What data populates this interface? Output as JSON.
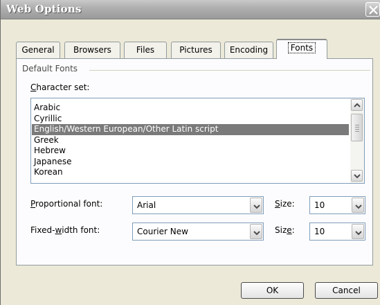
{
  "window": {
    "title": "Web Options",
    "close_icon": "close-icon"
  },
  "tabs": [
    {
      "label": "General",
      "active": false
    },
    {
      "label": "Browsers",
      "active": false
    },
    {
      "label": "Files",
      "active": false
    },
    {
      "label": "Pictures",
      "active": false
    },
    {
      "label": "Encoding",
      "active": false
    },
    {
      "label": "Fonts",
      "active": true
    }
  ],
  "fonts": {
    "group_label": "Default Fonts",
    "charset_label_prefix": "C",
    "charset_label_rest": "haracter set:",
    "charset_options": [
      {
        "label": "Arabic",
        "selected": false
      },
      {
        "label": "Cyrillic",
        "selected": false
      },
      {
        "label": "English/Western European/Other Latin script",
        "selected": true
      },
      {
        "label": "Greek",
        "selected": false
      },
      {
        "label": "Hebrew",
        "selected": false
      },
      {
        "label": "Japanese",
        "selected": false
      },
      {
        "label": "Korean",
        "selected": false
      }
    ],
    "proportional": {
      "label_prefix": "P",
      "label_rest": "roportional font:",
      "value": "Arial",
      "size_label_prefix": "S",
      "size_label_rest": "ize:",
      "size_value": "10"
    },
    "fixed": {
      "label_before": "Fixed-",
      "label_accel": "w",
      "label_after": "idth font:",
      "value": "Courier New",
      "size_label_before": "Siz",
      "size_label_accel": "e",
      "size_label_after": ":",
      "size_value": "10"
    }
  },
  "buttons": {
    "ok": "OK",
    "cancel": "Cancel"
  },
  "colors": {
    "selection": "#7a7a7a",
    "face": "#ece9d8",
    "panel": "#fcfcfe"
  }
}
